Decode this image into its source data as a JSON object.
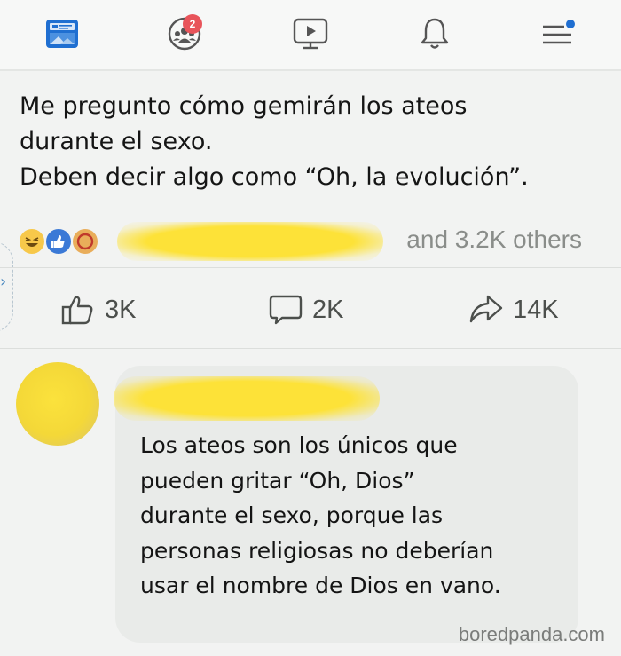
{
  "nav": {
    "icons": [
      "news-feed-icon",
      "groups-icon",
      "watch-icon",
      "notifications-icon",
      "menu-icon"
    ],
    "groups_badge": "2"
  },
  "post": {
    "lines": [
      "Me pregunto cómo gemirán los ateos",
      "durante el sexo.",
      "Deben decir algo como “Oh, la evolución”."
    ]
  },
  "reactions": {
    "others_text": "and 3.2K others",
    "types": [
      "haha",
      "like",
      "care"
    ]
  },
  "actions": {
    "like_count": "3K",
    "comment_count": "2K",
    "share_count": "14K"
  },
  "comment": {
    "lines": [
      "Los ateos son los únicos que",
      "pueden gritar “Oh, Dios”",
      "durante el sexo, porque las",
      "personas religiosas no deberían",
      "usar el nombre de Dios en vano."
    ]
  },
  "watermark": "boredpanda.com",
  "colors": {
    "accent_blue": "#1f6fd1",
    "badge_red": "#e8545a",
    "highlight_yellow": "#fde238"
  }
}
